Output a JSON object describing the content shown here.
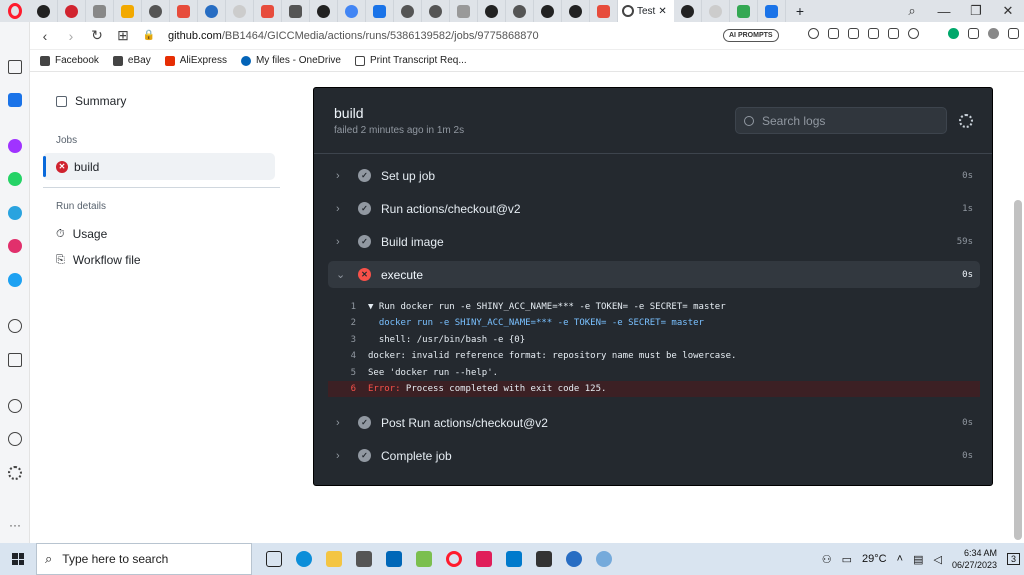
{
  "browser": {
    "active_tab_label": "Test",
    "url_domain": "github.com",
    "url_path": "/BB1464/GICCMedia/actions/runs/5386139582/jobs/9775868870",
    "ai_prompts_label": "AI PROMPTS",
    "bookmarks": [
      {
        "label": "Facebook",
        "icon": "facebook-icon"
      },
      {
        "label": "eBay",
        "icon": "ebay-icon"
      },
      {
        "label": "AliExpress",
        "icon": "aliexpress-icon"
      },
      {
        "label": "My files - OneDrive",
        "icon": "onedrive-icon"
      },
      {
        "label": "Print Transcript Req...",
        "icon": "document-icon"
      }
    ]
  },
  "sidebar": {
    "summary_label": "Summary",
    "jobs_heading": "Jobs",
    "job_build_label": "build",
    "run_details_heading": "Run details",
    "usage_label": "Usage",
    "workflow_file_label": "Workflow file"
  },
  "job": {
    "title": "build",
    "status_line": "failed 2 minutes ago in 1m 2s",
    "search_placeholder": "Search logs"
  },
  "steps": [
    {
      "name": "Set up job",
      "duration": "0s",
      "status": "success"
    },
    {
      "name": "Run actions/checkout@v2",
      "duration": "1s",
      "status": "success"
    },
    {
      "name": "Build image",
      "duration": "59s",
      "status": "success"
    },
    {
      "name": "execute",
      "duration": "0s",
      "status": "failure"
    },
    {
      "name": "Post Run actions/checkout@v2",
      "duration": "0s",
      "status": "success"
    },
    {
      "name": "Complete job",
      "duration": "0s",
      "status": "success"
    }
  ],
  "log_lines": [
    {
      "n": "1",
      "text": "▼ Run docker run -e SHINY_ACC_NAME=*** -e TOKEN= -e SECRET= master"
    },
    {
      "n": "2",
      "text": "  docker run -e SHINY_ACC_NAME=*** -e TOKEN= -e SECRET= master"
    },
    {
      "n": "3",
      "text": "  shell: /usr/bin/bash -e {0}"
    },
    {
      "n": "4",
      "text": "docker: invalid reference format: repository name must be lowercase."
    },
    {
      "n": "5",
      "text": "See 'docker run --help'."
    },
    {
      "n": "6",
      "prefix": "Error:",
      "text": " Process completed with exit code 125."
    }
  ],
  "taskbar": {
    "search_placeholder": "Type here to search",
    "temperature": "29°C",
    "time": "6:34 AM",
    "date": "06/27/2023",
    "notification_count": "3"
  },
  "colors": {
    "fail": "#cf222e",
    "accent": "#0969da",
    "log_bg": "#24292f"
  }
}
